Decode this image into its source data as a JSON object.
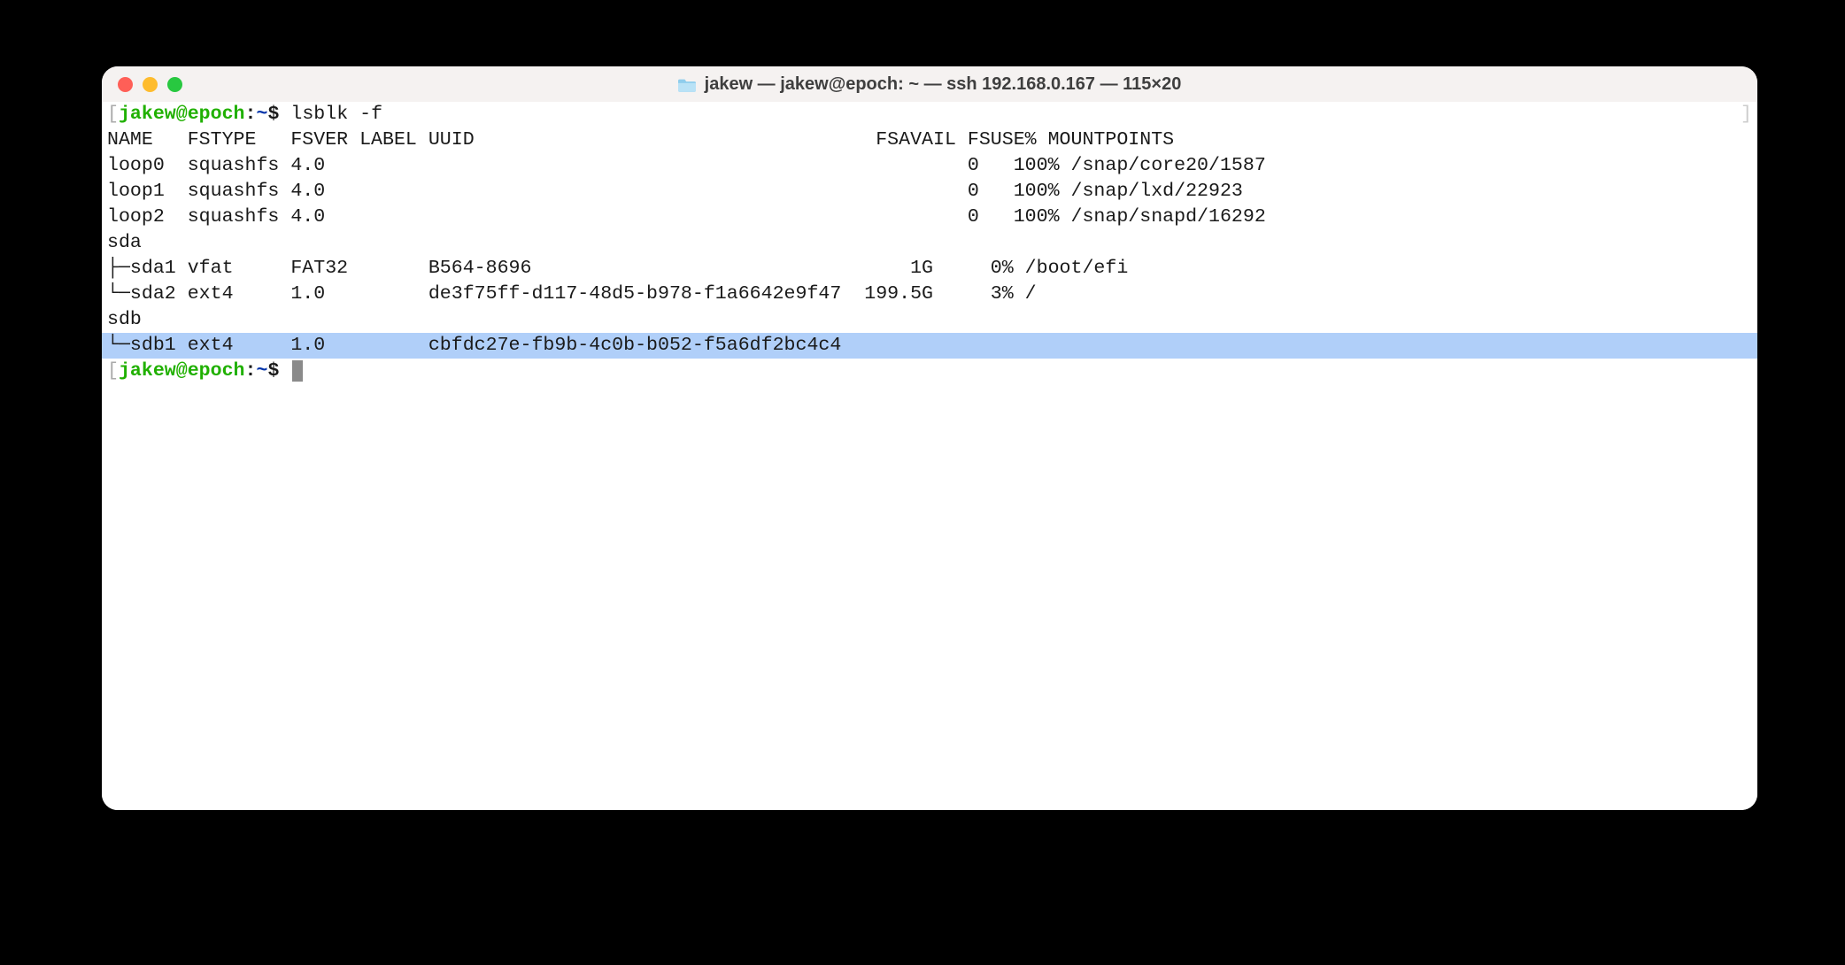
{
  "window": {
    "title": "jakew — jakew@epoch: ~ — ssh 192.168.0.167 — 115×20"
  },
  "prompt": {
    "bracket_open": "[",
    "bracket_close": "]",
    "user": "jakew@epoch",
    "sep": ":",
    "path": "~",
    "sigil": "$",
    "command": "lsblk -f"
  },
  "lsblk": {
    "header": "NAME   FSTYPE   FSVER LABEL UUID                                   FSAVAIL FSUSE% MOUNTPOINTS",
    "rows": [
      "loop0  squashfs 4.0                                                        0   100% /snap/core20/1587",
      "loop1  squashfs 4.0                                                        0   100% /snap/lxd/22923",
      "loop2  squashfs 4.0                                                        0   100% /snap/snapd/16292",
      "sda",
      "├─sda1 vfat     FAT32       B564-8696                                 1G     0% /boot/efi",
      "└─sda2 ext4     1.0         de3f75ff-d117-48d5-b978-f1a6642e9f47  199.5G     3% /",
      "sdb"
    ],
    "highlight_row": "└─sdb1 ext4     1.0         cbfdc27e-fb9b-4c0b-b052-f5a6df2bc4c4"
  }
}
